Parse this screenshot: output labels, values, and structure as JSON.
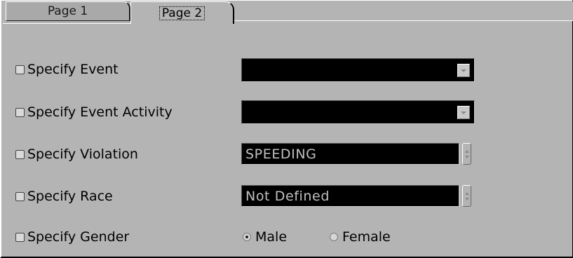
{
  "tabs": [
    {
      "label": "Page 1",
      "active": false
    },
    {
      "label": "Page 2",
      "active": true
    }
  ],
  "rows": {
    "event": {
      "label": "Specify Event",
      "checked": false,
      "value": ""
    },
    "event_activity": {
      "label": "Specify Event Activity",
      "checked": false,
      "value": ""
    },
    "violation": {
      "label": "Specify Violation",
      "checked": false,
      "value": "SPEEDING"
    },
    "race": {
      "label": "Specify Race",
      "checked": false,
      "value": "Not Defined"
    },
    "gender": {
      "label": "Specify Gender",
      "checked": false,
      "options": [
        {
          "label": "Male",
          "selected": true
        },
        {
          "label": "Female",
          "selected": false
        }
      ]
    }
  },
  "colors": {
    "panel": "#b4b4b4",
    "field_background": "#000000",
    "field_text": "#c0c0c0"
  },
  "icons": {
    "dropdown_arrow": "chevron-down-icon",
    "spinner": "up-down-arrows-icon"
  }
}
